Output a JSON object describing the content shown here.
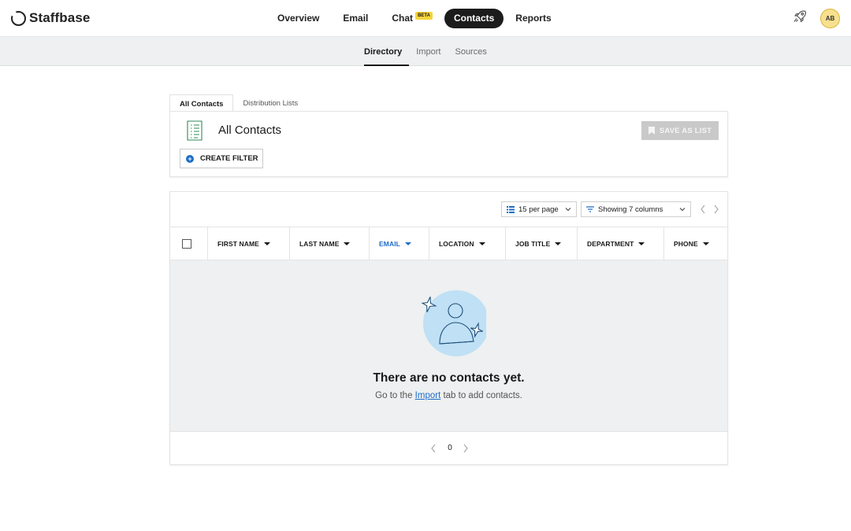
{
  "brand": {
    "name": "Staffbase"
  },
  "mainnav": [
    {
      "label": "Overview",
      "active": false
    },
    {
      "label": "Email",
      "active": false
    },
    {
      "label": "Chat",
      "badge": "BETA",
      "active": false
    },
    {
      "label": "Contacts",
      "active": true
    },
    {
      "label": "Reports",
      "active": false
    }
  ],
  "user": {
    "initials": "AB"
  },
  "subnav": [
    {
      "label": "Directory",
      "active": true
    },
    {
      "label": "Import",
      "active": false
    },
    {
      "label": "Sources",
      "active": false
    }
  ],
  "contact_tabs": [
    {
      "label": "All Contacts",
      "active": true
    },
    {
      "label": "Distribution Lists",
      "active": false
    }
  ],
  "header": {
    "title": "All Contacts",
    "save_label": "SAVE AS LIST",
    "create_filter_label": "CREATE FILTER"
  },
  "toolbar": {
    "per_page": "15 per page",
    "columns": "Showing 7 columns"
  },
  "table": {
    "columns": [
      "FIRST NAME",
      "LAST NAME",
      "EMAIL",
      "LOCATION",
      "JOB TITLE",
      "DEPARTMENT",
      "PHONE"
    ],
    "sorted_column": "EMAIL"
  },
  "empty_state": {
    "title": "There are no contacts yet.",
    "prefix": "Go to the",
    "link": "Import",
    "suffix": "tab to add contacts."
  },
  "pagination": {
    "page": "0"
  },
  "colors": {
    "accent": "#1e6cc8",
    "active_nav": "#1c1c1c",
    "beta": "#f5d43b",
    "avatar": "#f7e08e"
  }
}
